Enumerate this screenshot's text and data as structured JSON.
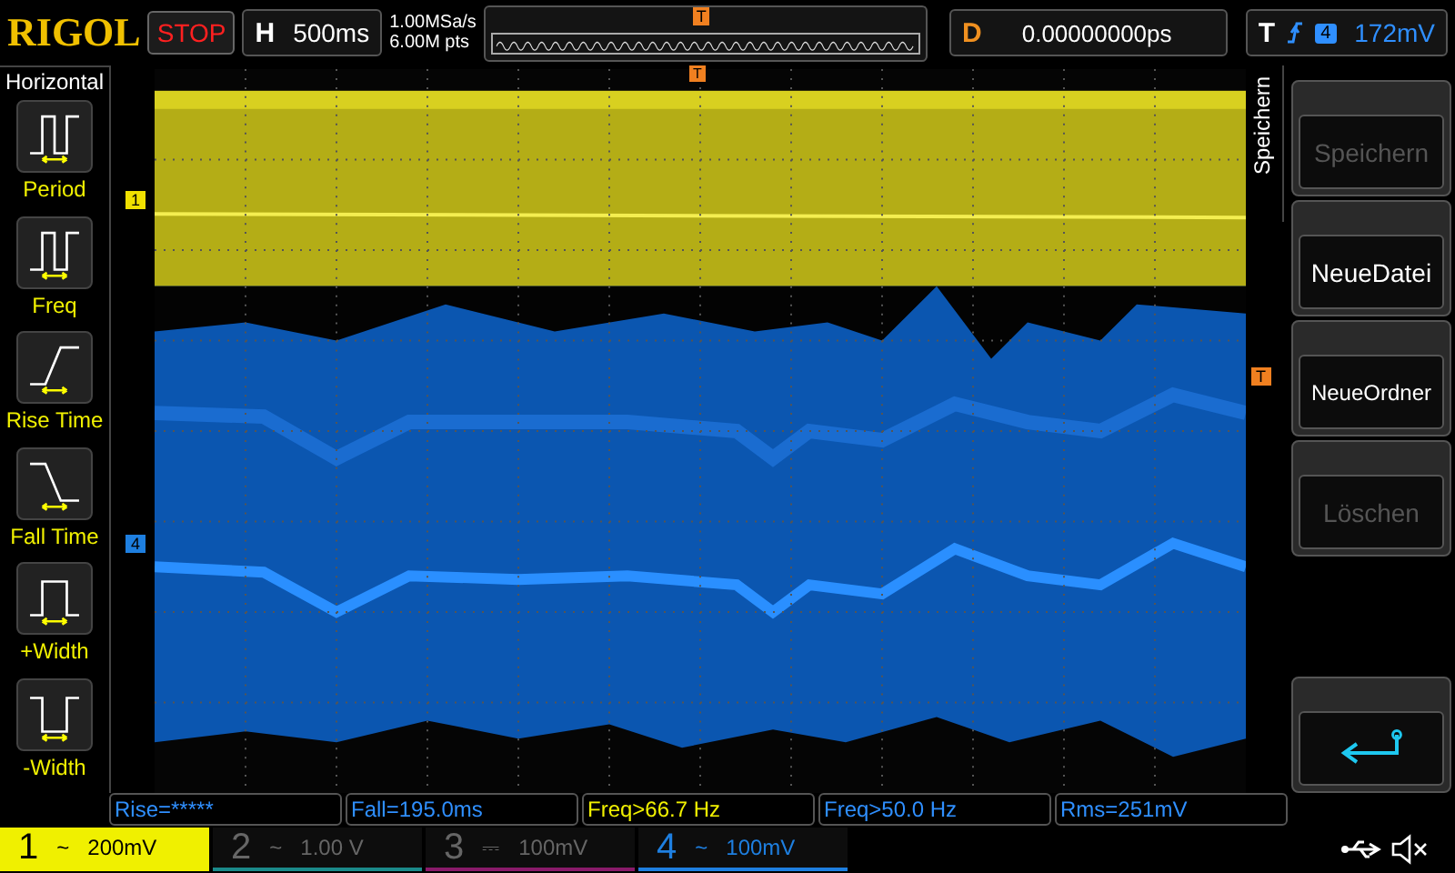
{
  "brand": "RIGOL",
  "run_state": "STOP",
  "horizontal": {
    "label": "H",
    "timebase": "500ms"
  },
  "sample_rate": "1.00MSa/s",
  "memory_depth": "6.00M pts",
  "timeline_marker": "T",
  "delay": {
    "label": "D",
    "value": "0.00000000ps"
  },
  "trigger": {
    "label": "T",
    "source": "4",
    "level": "172mV"
  },
  "left_menu": {
    "title": "Horizontal",
    "items": [
      {
        "kind": "period",
        "label": "Period"
      },
      {
        "kind": "freq",
        "label": "Freq"
      },
      {
        "kind": "rise",
        "label": "Rise Time"
      },
      {
        "kind": "fall",
        "label": "Fall Time"
      },
      {
        "kind": "pwidth",
        "label": "+Width"
      },
      {
        "kind": "nwidth",
        "label": "-Width"
      }
    ]
  },
  "plot": {
    "top_marker": "T",
    "channel_markers": [
      {
        "label": "1",
        "color": "#f0e000"
      },
      {
        "label": "4",
        "color": "#1e7fe0"
      }
    ],
    "trigger_level_marker": "T"
  },
  "right_menu": {
    "title": "Speichern",
    "buttons": [
      {
        "kind": "text",
        "label": "Speichern",
        "disabled": true
      },
      {
        "kind": "text",
        "label": "NeueDatei",
        "disabled": false
      },
      {
        "kind": "text",
        "label": "NeueOrdner",
        "disabled": false
      },
      {
        "kind": "text",
        "label": "Löschen",
        "disabled": true
      },
      {
        "kind": "spacer"
      },
      {
        "kind": "return"
      }
    ]
  },
  "measurements": [
    {
      "text": "Rise=*****",
      "color": "#2f8fff"
    },
    {
      "text": "Fall=195.0ms",
      "color": "#2f8fff"
    },
    {
      "text": "Freq>66.7 Hz",
      "color": "#f0f000"
    },
    {
      "text": "Freq>50.0 Hz",
      "color": "#2f8fff"
    },
    {
      "text": "Rms=251mV",
      "color": "#2f8fff"
    }
  ],
  "channels": [
    {
      "number": "1",
      "coupling": "~",
      "scale": "200mV",
      "color": "#f0f000",
      "selected": true,
      "enabled": true
    },
    {
      "number": "2",
      "coupling": "~",
      "scale": "1.00 V",
      "color": "#1a8a8a",
      "selected": false,
      "enabled": false
    },
    {
      "number": "3",
      "coupling": "⎓",
      "scale": "100mV",
      "color": "#8a1a6a",
      "selected": false,
      "enabled": false
    },
    {
      "number": "4",
      "coupling": "~",
      "scale": "100mV",
      "color": "#1e7fe0",
      "selected": false,
      "enabled": true
    }
  ]
}
